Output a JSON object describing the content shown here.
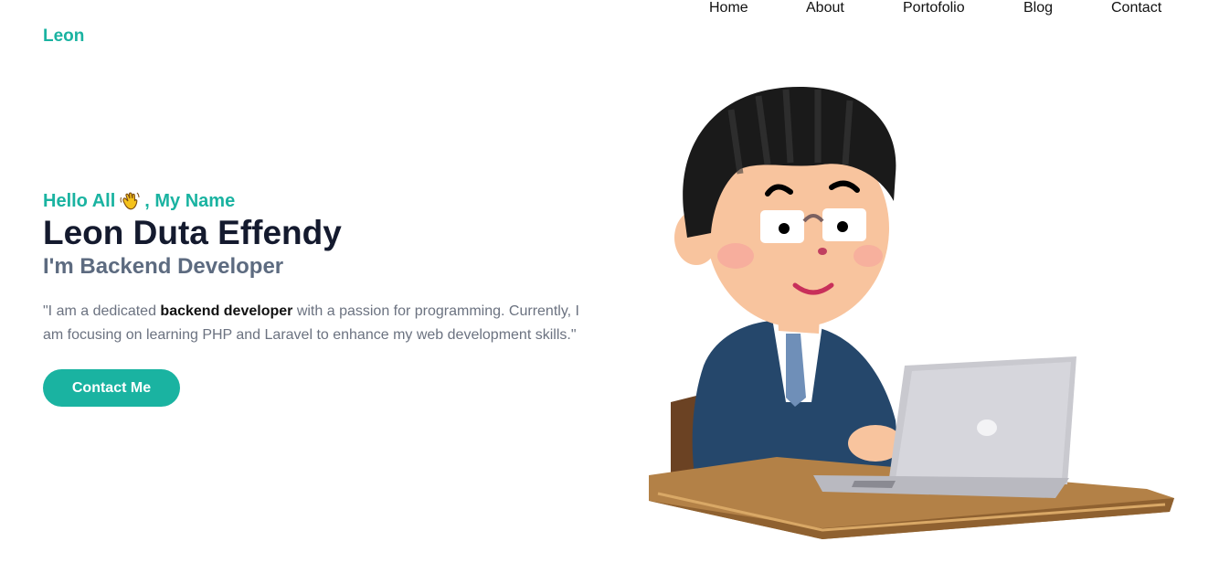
{
  "brand": "Leon",
  "nav": [
    {
      "label": "Home"
    },
    {
      "label": "About"
    },
    {
      "label": "Portofolio"
    },
    {
      "label": "Blog"
    },
    {
      "label": "Contact"
    }
  ],
  "hero": {
    "greeting_before": "Hello All",
    "greeting_emoji_icon": "waving-hand-icon",
    "greeting_after": ", My Name",
    "name": "Leon Duta Effendy",
    "role": "I'm Backend Developer",
    "bio_prefix": "\"I am a dedicated ",
    "bio_bold": "backend developer",
    "bio_suffix": " with a passion for programming. Currently, I am focusing on learning PHP and Laravel to enhance my web development skills.\"",
    "cta_label": "Contact Me"
  },
  "colors": {
    "accent": "#1ab3a1",
    "heading": "#141a2e",
    "muted": "#5d6b80"
  },
  "illustration_icon": "developer-at-laptop-illustration"
}
